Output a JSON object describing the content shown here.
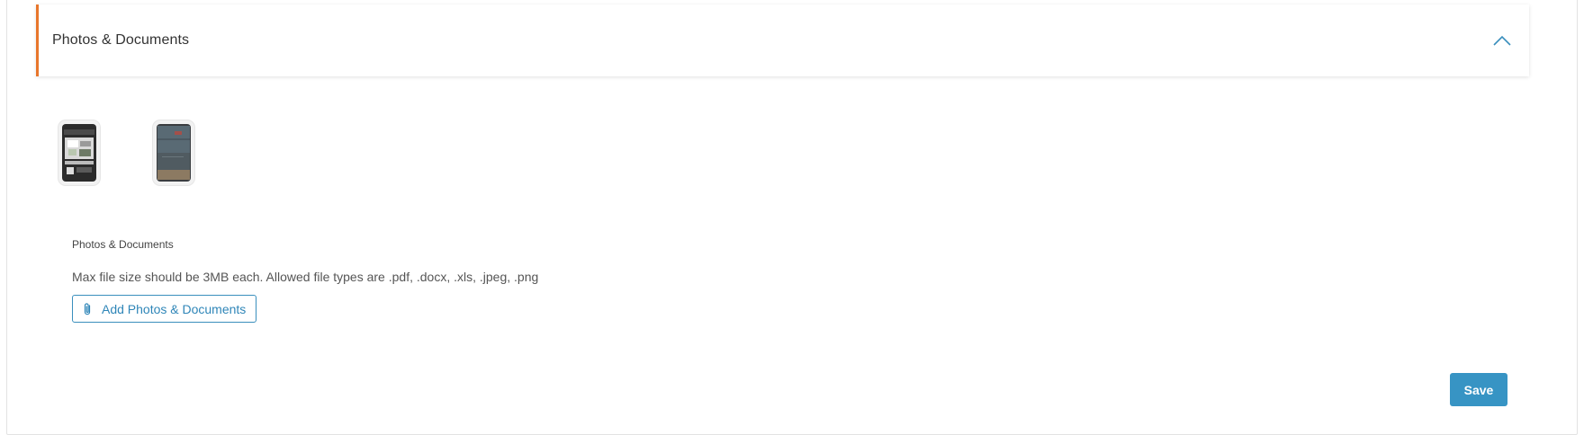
{
  "section": {
    "title": "Photos & Documents",
    "collapse_icon": "chevron-up-icon"
  },
  "thumbnails": [
    {
      "kind": "photo",
      "icon": "image-thumbnail-icon"
    },
    {
      "kind": "photo",
      "icon": "image-thumbnail-icon"
    }
  ],
  "upload": {
    "label": "Photos & Documents",
    "help_text": "Max file size should be 3MB each. Allowed file types are .pdf, .docx, .xls, .jpeg, .png",
    "button_label": "Add Photos & Documents",
    "button_icon": "paperclip-icon"
  },
  "actions": {
    "save_label": "Save"
  },
  "colors": {
    "accent_orange": "#e8762b",
    "primary_blue": "#3794c4",
    "link_blue": "#2f86b8"
  }
}
